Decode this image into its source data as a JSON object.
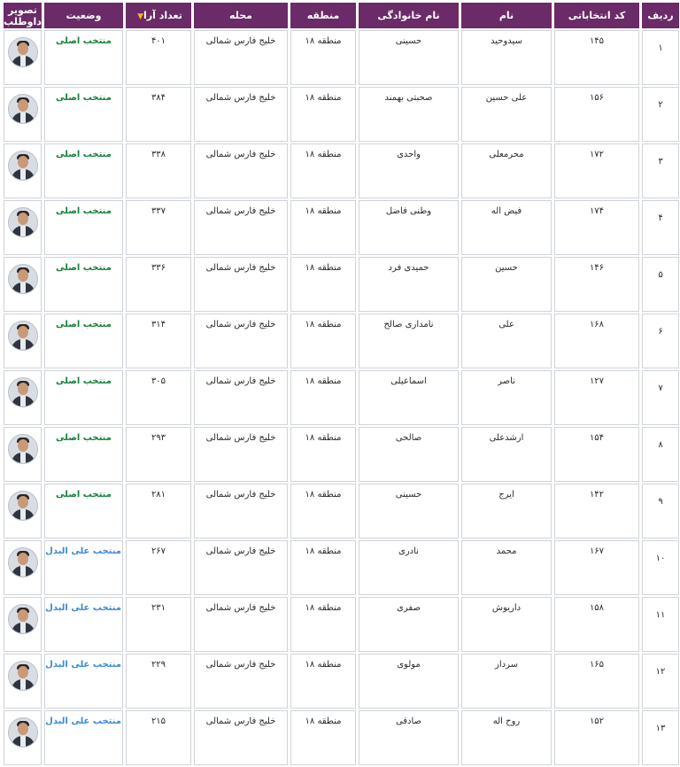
{
  "table": {
    "headers": {
      "row_no": "ردیف",
      "code": "کد انتخاباتی",
      "first_name": "نام",
      "last_name": "نام خانوادگی",
      "district": "منطقه",
      "neighborhood": "محله",
      "votes": "تعداد آرا",
      "status": "وضعیت",
      "photo": "تصویر داوطلب"
    },
    "rows": [
      {
        "row_no": "۱",
        "code": "۱۴۵",
        "first_name": "سیدوحید",
        "last_name": "حسینی",
        "district": "منطقه ۱۸",
        "neighborhood": "خلیج فارس شمالی",
        "votes": "۴۰۱",
        "status": "منتخب اصلی",
        "status_type": "main"
      },
      {
        "row_no": "۲",
        "code": "۱۵۶",
        "first_name": "علی حسین",
        "last_name": "صحبتی بهمند",
        "district": "منطقه ۱۸",
        "neighborhood": "خلیج فارس شمالی",
        "votes": "۳۸۴",
        "status": "منتخب اصلی",
        "status_type": "main"
      },
      {
        "row_no": "۳",
        "code": "۱۷۲",
        "first_name": "محرمعلی",
        "last_name": "واحدی",
        "district": "منطقه ۱۸",
        "neighborhood": "خلیج فارس شمالی",
        "votes": "۳۳۸",
        "status": "منتخب اصلی",
        "status_type": "main"
      },
      {
        "row_no": "۴",
        "code": "۱۷۴",
        "first_name": "فیض اله",
        "last_name": "وطنی فاضل",
        "district": "منطقه ۱۸",
        "neighborhood": "خلیج فارس شمالی",
        "votes": "۳۳۷",
        "status": "منتخب اصلی",
        "status_type": "main"
      },
      {
        "row_no": "۵",
        "code": "۱۴۶",
        "first_name": "حسین",
        "last_name": "حمیدی فرد",
        "district": "منطقه ۱۸",
        "neighborhood": "خلیج فارس شمالی",
        "votes": "۳۳۶",
        "status": "منتخب اصلی",
        "status_type": "main"
      },
      {
        "row_no": "۶",
        "code": "۱۶۸",
        "first_name": "علی",
        "last_name": "نامداری صالح",
        "district": "منطقه ۱۸",
        "neighborhood": "خلیج فارس شمالی",
        "votes": "۳۱۴",
        "status": "منتخب اصلی",
        "status_type": "main"
      },
      {
        "row_no": "۷",
        "code": "۱۲۷",
        "first_name": "ناصر",
        "last_name": "اسماعیلی",
        "district": "منطقه ۱۸",
        "neighborhood": "خلیج فارس شمالی",
        "votes": "۳۰۵",
        "status": "منتخب اصلی",
        "status_type": "main"
      },
      {
        "row_no": "۸",
        "code": "۱۵۴",
        "first_name": "ارشدعلی",
        "last_name": "صالحی",
        "district": "منطقه ۱۸",
        "neighborhood": "خلیج فارس شمالی",
        "votes": "۲۹۳",
        "status": "منتخب اصلی",
        "status_type": "main"
      },
      {
        "row_no": "۹",
        "code": "۱۴۲",
        "first_name": "ایرج",
        "last_name": "حسینی",
        "district": "منطقه ۱۸",
        "neighborhood": "خلیج فارس شمالی",
        "votes": "۲۸۱",
        "status": "منتخب اصلی",
        "status_type": "main"
      },
      {
        "row_no": "۱۰",
        "code": "۱۶۷",
        "first_name": "محمد",
        "last_name": "نادری",
        "district": "منطقه ۱۸",
        "neighborhood": "خلیج فارس شمالی",
        "votes": "۲۶۷",
        "status": "منتخب علی البدل",
        "status_type": "alt"
      },
      {
        "row_no": "۱۱",
        "code": "۱۵۸",
        "first_name": "داریوش",
        "last_name": "صفری",
        "district": "منطقه ۱۸",
        "neighborhood": "خلیج فارس شمالی",
        "votes": "۲۳۱",
        "status": "منتخب علی البدل",
        "status_type": "alt"
      },
      {
        "row_no": "۱۲",
        "code": "۱۶۵",
        "first_name": "سردار",
        "last_name": "مولوی",
        "district": "منطقه ۱۸",
        "neighborhood": "خلیج فارس شمالی",
        "votes": "۲۲۹",
        "status": "منتخب علی البدل",
        "status_type": "alt"
      },
      {
        "row_no": "۱۳",
        "code": "۱۵۲",
        "first_name": "روح اله",
        "last_name": "صادقی",
        "district": "منطقه ۱۸",
        "neighborhood": "خلیج فارس شمالی",
        "votes": "۲۱۵",
        "status": "منتخب علی البدل",
        "status_type": "alt"
      }
    ]
  },
  "icons": {
    "sort": "sort-descending-icon",
    "photo": "candidate-photo-icon"
  },
  "colors": {
    "header_bg": "#6b2a68",
    "status_main": "#16823b",
    "status_alt": "#3a8bd6",
    "sort_arrow": "#f2b21b"
  }
}
